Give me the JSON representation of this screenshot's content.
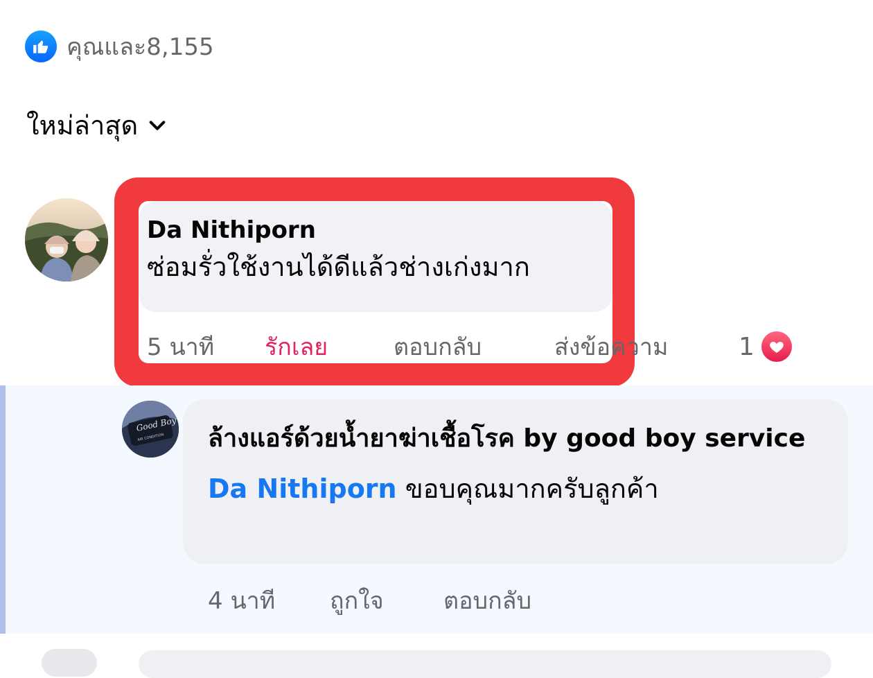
{
  "reactions": {
    "summary_text": "คุณและ8,155",
    "icon": "like-icon",
    "accent_color": "#0866ff"
  },
  "sort": {
    "label": "ใหม่ล่าสุด",
    "icon": "chevron-down-icon"
  },
  "comment": {
    "author": "Da Nithiporn",
    "text": "ซ่อมรั่วใช้งานได้ดีแล้วช่างเก่งมาก",
    "time": "5 นาที",
    "love_label": "รักเลย",
    "reply_label": "ตอบกลับ",
    "message_label": "ส่งข้อความ",
    "reaction_count": "1",
    "reaction_icon": "heart-icon",
    "highlight_color": "#f03a3e"
  },
  "reply": {
    "author": "ล้างแอร์ด้วยน้ำยาฆ่าเชื้อโรค by good boy service",
    "mention": "Da Nithiporn",
    "text": "ขอบคุณมากครับลูกค้า",
    "time": "4 นาที",
    "like_label": "ถูกใจ",
    "reply_label": "ตอบกลับ"
  }
}
